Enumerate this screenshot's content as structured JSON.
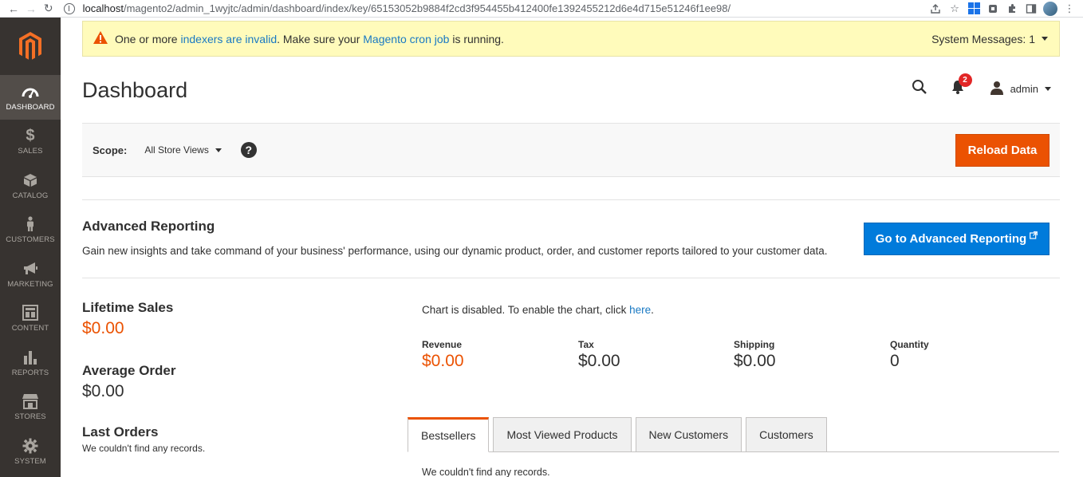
{
  "browser": {
    "url_host": "localhost",
    "url_path": "/magento2/admin_1wyjtc/admin/dashboard/index/key/65153052b9884f2cd3f954455b412400fe1392455212d6e4d715e51246f1ee98/"
  },
  "sidebar": {
    "items": [
      {
        "label": "DASHBOARD",
        "icon": "dashboard-icon",
        "active": true
      },
      {
        "label": "SALES",
        "icon": "dollar-icon"
      },
      {
        "label": "CATALOG",
        "icon": "box-icon"
      },
      {
        "label": "CUSTOMERS",
        "icon": "person-icon"
      },
      {
        "label": "MARKETING",
        "icon": "megaphone-icon"
      },
      {
        "label": "CONTENT",
        "icon": "layout-icon"
      },
      {
        "label": "REPORTS",
        "icon": "bar-chart-icon"
      },
      {
        "label": "STORES",
        "icon": "store-icon"
      },
      {
        "label": "SYSTEM",
        "icon": "gear-icon"
      }
    ]
  },
  "system_message": {
    "text_before": "One or more ",
    "link1": "indexers are invalid",
    "text_middle": ". Make sure your ",
    "link2": "Magento cron job",
    "text_after": " is running.",
    "counter": "System Messages: 1"
  },
  "header": {
    "title": "Dashboard",
    "notifications_count": "2",
    "user": "admin"
  },
  "scope": {
    "label": "Scope:",
    "value": "All Store Views",
    "help": "?",
    "reload_button": "Reload Data"
  },
  "advanced_reporting": {
    "title": "Advanced Reporting",
    "text": "Gain new insights and take command of your business' performance, using our dynamic product, order, and customer reports tailored to your customer data.",
    "button": "Go to Advanced Reporting"
  },
  "stats": {
    "lifetime_sales_label": "Lifetime Sales",
    "lifetime_sales_value": "$0.00",
    "average_order_label": "Average Order",
    "average_order_value": "$0.00",
    "last_orders_label": "Last Orders",
    "last_orders_empty": "We couldn't find any records."
  },
  "chart": {
    "note_before": "Chart is disabled. To enable the chart, click ",
    "note_link": "here",
    "note_after": "."
  },
  "metrics": [
    {
      "label": "Revenue",
      "value": "$0.00"
    },
    {
      "label": "Tax",
      "value": "$0.00"
    },
    {
      "label": "Shipping",
      "value": "$0.00"
    },
    {
      "label": "Quantity",
      "value": "0"
    }
  ],
  "tabs": [
    {
      "label": "Bestsellers",
      "active": true
    },
    {
      "label": "Most Viewed Products"
    },
    {
      "label": "New Customers"
    },
    {
      "label": "Customers"
    }
  ],
  "tab_content": {
    "empty": "We couldn't find any records."
  },
  "colors": {
    "accent": "#eb5202",
    "sidebar_bg": "#373330",
    "link": "#1979c3",
    "advanced_button": "#007bdb"
  }
}
